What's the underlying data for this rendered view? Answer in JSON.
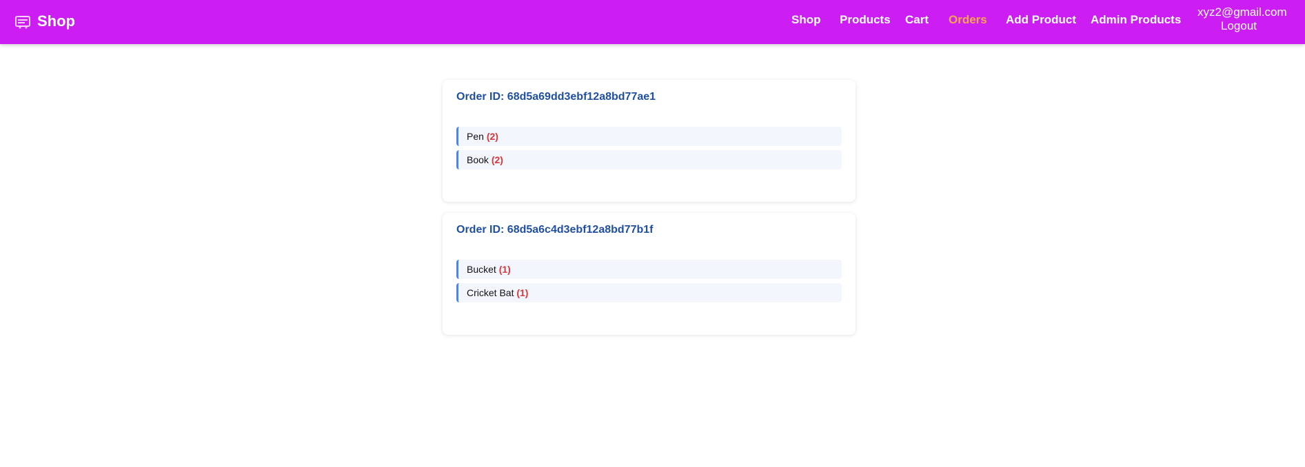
{
  "navbar": {
    "brand": "Shop",
    "links": [
      {
        "label": "Shop",
        "active": false
      },
      {
        "label": "Products",
        "active": false
      },
      {
        "label": "Cart",
        "active": false
      },
      {
        "label": "Orders",
        "active": true
      },
      {
        "label": "Add Product",
        "active": false
      },
      {
        "label": "Admin Products",
        "active": false
      }
    ],
    "user_email": "xyz2@gmail.com",
    "logout_label": "Logout",
    "bg_color": "#cc1ef2",
    "active_color": "#ffa64d"
  },
  "orders": [
    {
      "title": "Order ID: 68d5a69dd3ebf12a8bd77ae1",
      "items": [
        {
          "name": "Pen",
          "qty": "(2)"
        },
        {
          "name": "Book",
          "qty": "(2)"
        }
      ]
    },
    {
      "title": "Order ID: 68d5a6c4d3ebf12a8bd77b1f",
      "items": [
        {
          "name": "Bucket",
          "qty": "(1)"
        },
        {
          "name": "Cricket Bat",
          "qty": "(1)"
        }
      ]
    }
  ]
}
